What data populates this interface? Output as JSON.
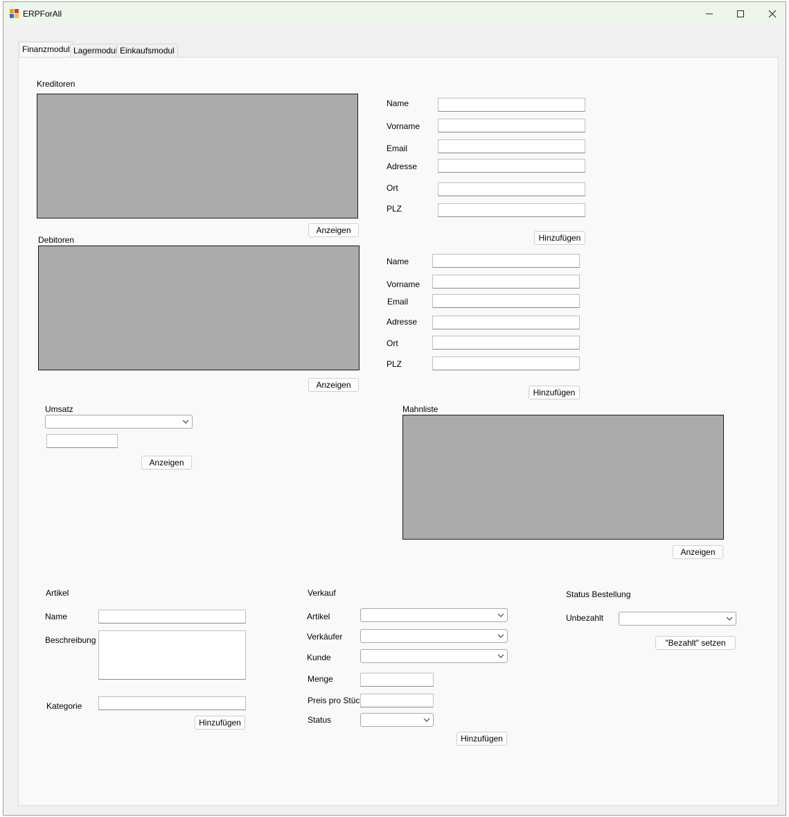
{
  "window": {
    "title": "ERPForAll",
    "controls": {
      "minimize": "minimize-icon",
      "maximize": "maximize-icon",
      "close": "close-icon"
    }
  },
  "tabs": [
    "Finanzmodul",
    "Lagermodul",
    "Einkaufsmodul"
  ],
  "active_tab": "Finanzmodul",
  "kreditoren": {
    "title": "Kreditoren",
    "show_button": "Anzeigen",
    "form": {
      "name_label": "Name",
      "vorname_label": "Vorname",
      "email_label": "Email",
      "adresse_label": "Adresse",
      "ort_label": "Ort",
      "plz_label": "PLZ",
      "name_value": "",
      "vorname_value": "",
      "email_value": "",
      "adresse_value": "",
      "ort_value": "",
      "plz_value": "",
      "add_button": "Hinzufügen"
    }
  },
  "debitoren": {
    "title": "Debitoren",
    "show_button": "Anzeigen",
    "form": {
      "name_label": "Name",
      "vorname_label": "Vorname",
      "email_label": "Email",
      "adresse_label": "Adresse",
      "ort_label": "Ort",
      "plz_label": "PLZ",
      "name_value": "",
      "vorname_value": "",
      "email_value": "",
      "adresse_value": "",
      "ort_value": "",
      "plz_value": "",
      "add_button": "Hinzufügen"
    }
  },
  "umsatz": {
    "title": "Umsatz",
    "select_value": "",
    "result_value": "",
    "show_button": "Anzeigen"
  },
  "mahnliste": {
    "title": "Mahnliste",
    "show_button": "Anzeigen"
  },
  "artikel": {
    "title": "Artikel",
    "name_label": "Name",
    "name_value": "",
    "beschreibung_label": "Beschreibung",
    "beschreibung_value": "",
    "kategorie_label": "Kategorie",
    "kategorie_value": "",
    "add_button": "Hinzufügen"
  },
  "verkauf": {
    "title": "Verkauf",
    "artikel_label": "Artikel",
    "artikel_value": "",
    "verkaeufer_label": "Verkäufer",
    "verkaeufer_value": "",
    "kunde_label": "Kunde",
    "kunde_value": "",
    "menge_label": "Menge",
    "menge_value": "",
    "preis_label": "Preis pro Stück",
    "preis_value": "",
    "status_label": "Status",
    "status_value": "",
    "add_button": "Hinzufügen"
  },
  "status_bestellung": {
    "title": "Status Bestellung",
    "unbezahlt_label": "Unbezahlt",
    "unbezahlt_value": "",
    "set_paid_button": "\"Bezahlt\" setzen"
  },
  "colors": {
    "grid_bg": "#ababab",
    "titlebar_bg": "#eef6ec",
    "page_bg": "#f9f9f9"
  }
}
